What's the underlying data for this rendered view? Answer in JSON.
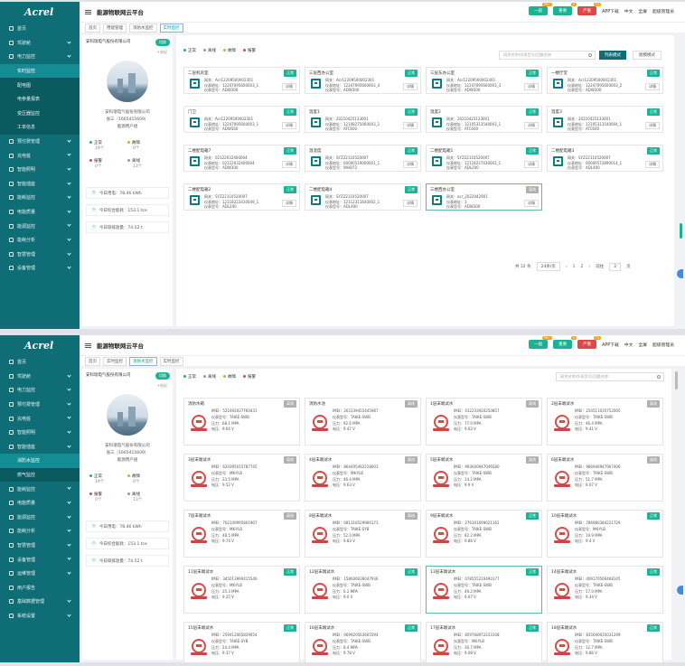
{
  "app": {
    "logo": "Acrel",
    "title": "能源物联网云平台"
  },
  "topbar": {
    "badges": [
      {
        "label": "一般",
        "count": "99+",
        "color": "#1ab394"
      },
      {
        "label": "重要",
        "count": "5",
        "color": "#1ab394"
      },
      {
        "label": "严重",
        "count": "72",
        "color": "#e04848"
      }
    ],
    "links": [
      "APP下载",
      "中文",
      "全屏",
      "超级管理员"
    ]
  },
  "panel1": {
    "sidebar": [
      {
        "label": "首页",
        "arrow": false
      },
      {
        "label": "驾驶舱",
        "arrow": true
      },
      {
        "label": "电力监控",
        "arrow": true,
        "children": [
          {
            "label": "实时监控",
            "active": true
          },
          {
            "label": "配电图"
          },
          {
            "label": "电参量报表"
          },
          {
            "label": "变压器监控"
          },
          {
            "label": "工单信息"
          }
        ]
      },
      {
        "label": "预付费管理",
        "arrow": true
      },
      {
        "label": "充电桩",
        "arrow": true
      },
      {
        "label": "智能照明",
        "arrow": true
      },
      {
        "label": "智能插座",
        "arrow": true
      },
      {
        "label": "能耗监控",
        "arrow": true
      },
      {
        "label": "电能质量",
        "arrow": true
      },
      {
        "label": "能源监控",
        "arrow": true
      },
      {
        "label": "能耗分析",
        "arrow": true
      },
      {
        "label": "智慧管理",
        "arrow": true
      },
      {
        "label": "设备管理",
        "arrow": true
      }
    ],
    "tabs": [
      "首页",
      "用能管理",
      "消防水监控",
      "实时监控"
    ],
    "active_tab": 3,
    "company": {
      "name": "安科瑞电气股份有限公司",
      "toggle": "切换",
      "collect": "+收起",
      "full_name": "安科瑞电气股份有限公司",
      "contact": "张三（1665415609）",
      "group": "能源用户组"
    },
    "stats": [
      {
        "label": "正常",
        "value": "19",
        "unit": "个",
        "color": "#1ab394"
      },
      {
        "label": "故障",
        "value": "0",
        "unit": "个",
        "color": "#f0a020"
      },
      {
        "label": "报警",
        "value": "0",
        "unit": "个",
        "color": "#e04848"
      },
      {
        "label": "离线",
        "value": "13",
        "unit": "个",
        "color": "#999999"
      }
    ],
    "infos": [
      "今日用电：78.46 kWh",
      "今日综合能耗：153.1 tce",
      "今日碳排放量：74.52 t"
    ],
    "legend": [
      {
        "label": "正常",
        "color": "#1ab394"
      },
      {
        "label": "离线",
        "color": "#999999"
      },
      {
        "label": "故障",
        "color": "#f0a020"
      },
      {
        "label": "报警",
        "color": "#e04848"
      }
    ],
    "search_placeholder": "网关名称/仪表型号/回路名称",
    "list_mode": "列表模式",
    "chart_mode": "图模模式",
    "labels": {
      "gw": "网关：",
      "addr": "仪表地址：",
      "model": "仪表型号：",
      "detail": "详情"
    },
    "cards": [
      {
        "name": "二层机房室",
        "status": "正常",
        "gw": "Acr12209500002301",
        "addr": "12247095600003_1",
        "model": "ADW300"
      },
      {
        "name": "三层西办公室",
        "status": "正常",
        "gw": "Acr12209500002301",
        "addr": "12247095600003_4",
        "model": "ADW300"
      },
      {
        "name": "三层东办公室",
        "status": "正常",
        "gw": "Acr12209500002301",
        "addr": "12247095600003_3",
        "model": "ADW300"
      },
      {
        "name": "一楼厅堂",
        "status": "正常",
        "gw": "Acr12209500002301",
        "addr": "12247095600003_2",
        "model": "ADW300"
      },
      {
        "name": "门卫",
        "status": "正常",
        "gw": "Acr12209500002301",
        "addr": "12247095600003_1",
        "model": "ADW300"
      },
      {
        "name": "温度1",
        "status": "正常",
        "gw": "20210425133001",
        "addr": "12108275060003_1",
        "model": "ATC600"
      },
      {
        "name": "温度2",
        "status": "正常",
        "gw": "20210425133001",
        "addr": "12105313540003_1",
        "model": "ATC600"
      },
      {
        "name": "温度3",
        "status": "正常",
        "gw": "20210425133001",
        "addr": "12105313540004_1",
        "model": "ATC600"
      },
      {
        "name": "二楼配电箱7",
        "status": "正常",
        "gw": "02122032400004",
        "addr": "02122032400004",
        "model": "ADW300"
      },
      {
        "name": "温湿度",
        "status": "正常",
        "gw": "SYZ22110520007",
        "addr": "00000519000001_1",
        "model": "WHD72"
      },
      {
        "name": "二楼配电箱1",
        "status": "正常",
        "gw": "SYZ22110520007",
        "addr": "12118227430003_1",
        "model": "ADL200"
      },
      {
        "name": "二楼配电箱3",
        "status": "正常",
        "gw": "SYZ22110520007",
        "addr": "00009572890014_1",
        "model": "ADL400"
      },
      {
        "name": "二楼配电箱2",
        "status": "正常",
        "gw": "SYZ22110520007",
        "addr": "12118223430049_1",
        "model": "ADL200"
      },
      {
        "name": "二楼配电箱4",
        "status": "正常",
        "gw": "SYZ22110520007",
        "addr": "12112311640002_1",
        "model": "ADL400"
      },
      {
        "name": "三楼西办公室",
        "status": "离线",
        "gw": "acr_2022042901",
        "addr": "3",
        "model": "ADW300"
      }
    ],
    "pagination": {
      "total": "共 32 条",
      "per_page": "24条/页",
      "pages": [
        "1",
        "2"
      ],
      "current": "1",
      "goto_label": "前往",
      "goto_value": "2",
      "page_unit": "页"
    }
  },
  "panel2": {
    "sidebar": [
      {
        "label": "首页",
        "arrow": false
      },
      {
        "label": "驾驶舱",
        "arrow": true
      },
      {
        "label": "电力监控",
        "arrow": true
      },
      {
        "label": "预付费管理",
        "arrow": true
      },
      {
        "label": "充电桩",
        "arrow": true
      },
      {
        "label": "智能照明",
        "arrow": true
      },
      {
        "label": "智能插座",
        "arrow": true,
        "children": [
          {
            "label": "消防水监控",
            "active": true
          },
          {
            "label": "燃气监控"
          }
        ]
      },
      {
        "label": "能耗监控",
        "arrow": true
      },
      {
        "label": "电能质量",
        "arrow": true
      },
      {
        "label": "能源监控",
        "arrow": true
      },
      {
        "label": "能耗分析",
        "arrow": true
      },
      {
        "label": "智慧管理",
        "arrow": true
      },
      {
        "label": "设备管理",
        "arrow": true
      },
      {
        "label": "运维管理",
        "arrow": true
      },
      {
        "label": "用户报告",
        "arrow": false
      },
      {
        "label": "基础数据管理",
        "arrow": true
      },
      {
        "label": "系统设置",
        "arrow": true
      }
    ],
    "tabs": [
      "首页",
      "实时监控",
      "消防水监控",
      "实时监控"
    ],
    "active_tab": 2,
    "labels": {
      "imei": "IMEI：",
      "model": "仪表型号：",
      "pressure": "压力：",
      "voltage": "电压："
    },
    "cards": [
      {
        "name": "消防水箱",
        "status": "离线",
        "imei": "521692037760431",
        "model": "TAIKE-SWB",
        "pressure": "68.1 MPA",
        "voltage": "9.64 V"
      },
      {
        "name": "消防水池",
        "status": "离线",
        "imei": "203139455445987",
        "model": "TAIKE-SWB",
        "pressure": "92.6 MPA",
        "voltage": "9.47 V"
      },
      {
        "name": "1层末端试水",
        "status": "离线",
        "imei": "412233920250857",
        "model": "TAIKE-SWB",
        "pressure": "77.0 MPA",
        "voltage": "9.62 V"
      },
      {
        "name": "2层末端试水",
        "status": "离线",
        "imei": "254511035752005",
        "model": "TAIKE-SWB",
        "pressure": "46.4 MPA",
        "voltage": "9.41 V"
      },
      {
        "name": "3层末端试水",
        "status": "离线",
        "imei": "620395015787745",
        "model": "MK-YLB",
        "pressure": "23.5 MPA",
        "voltage": "9.52 V"
      },
      {
        "name": "4层末端试水",
        "status": "离线",
        "imei": "864495492218003",
        "model": "MK-YLB",
        "pressure": "46.4 MPA",
        "voltage": "9.63 V"
      },
      {
        "name": "5层末端试水",
        "status": "离线",
        "imei": "993600947046580",
        "model": "TAIKE-SWB",
        "pressure": "14.2 MPA",
        "voltage": "9.9 V"
      },
      {
        "name": "6层末端试水",
        "status": "离线",
        "imei": "986946947907406",
        "model": "TAIKE-SWB",
        "pressure": "51.7 MPA",
        "voltage": "9.07 V"
      },
      {
        "name": "7层末端试水",
        "status": "离线",
        "imei": "702109995801907",
        "model": "MK-YLB",
        "pressure": "48.5 MPA",
        "voltage": "9.74 V"
      },
      {
        "name": "8层末端试水",
        "status": "离线",
        "imei": "081318529966173",
        "model": "TAIKE-SYB",
        "pressure": "52.0 MPA",
        "voltage": "9.83 V"
      },
      {
        "name": "9层末端试水",
        "status": "正常",
        "imei": "276301699021162",
        "model": "TAIKE-SWB",
        "pressure": "82.2 MPA",
        "voltage": "9.86 V"
      },
      {
        "name": "10层末端试水",
        "status": "正常",
        "imei": "786980384221729",
        "model": "MK-YLB",
        "pressure": "19.9 MPA",
        "voltage": "9.4 V"
      },
      {
        "name": "11层末端试水",
        "status": "正常",
        "imei": "345013990415546",
        "model": "MK-YLB",
        "pressure": "25.3 MPA",
        "voltage": "9.25 V"
      },
      {
        "name": "12层末端试水",
        "status": "正常",
        "imei": "158606036047936",
        "model": "TAIKE-SWB",
        "pressure": "6.2 MPA",
        "voltage": "9.0 V"
      },
      {
        "name": "13层末端试水",
        "status": "正常",
        "imei": "078555210490177",
        "model": "TAIKE-SWB",
        "pressure": "49.2 MPA",
        "voltage": "9.67 V"
      },
      {
        "name": "14层末端试水",
        "status": "正常",
        "imei": "409170566468145",
        "model": "TAIKE-SWB",
        "pressure": "57.0 MPA",
        "voltage": "9.34 V"
      },
      {
        "name": "15层末端试水",
        "status": "正常",
        "imei": "259412065839054",
        "model": "TAIKE-SYB",
        "pressure": "24.4 MPA",
        "voltage": "9.37 V"
      },
      {
        "name": "16层末端试水",
        "status": "正常",
        "imei": "069920563605594",
        "model": "TAIKE-SWB",
        "pressure": "8.4 MPA",
        "voltage": "9.78 V"
      },
      {
        "name": "17层末端试水",
        "status": "正常",
        "imei": "859768972233108",
        "model": "MK-YLB",
        "pressure": "30.7 MPA",
        "voltage": "9.08 V"
      },
      {
        "name": "18层末端试水",
        "status": "正常",
        "imei": "835690035031299",
        "model": "TAIKE-SWB",
        "pressure": "12.7 MPA",
        "voltage": "9.86 V"
      }
    ]
  }
}
